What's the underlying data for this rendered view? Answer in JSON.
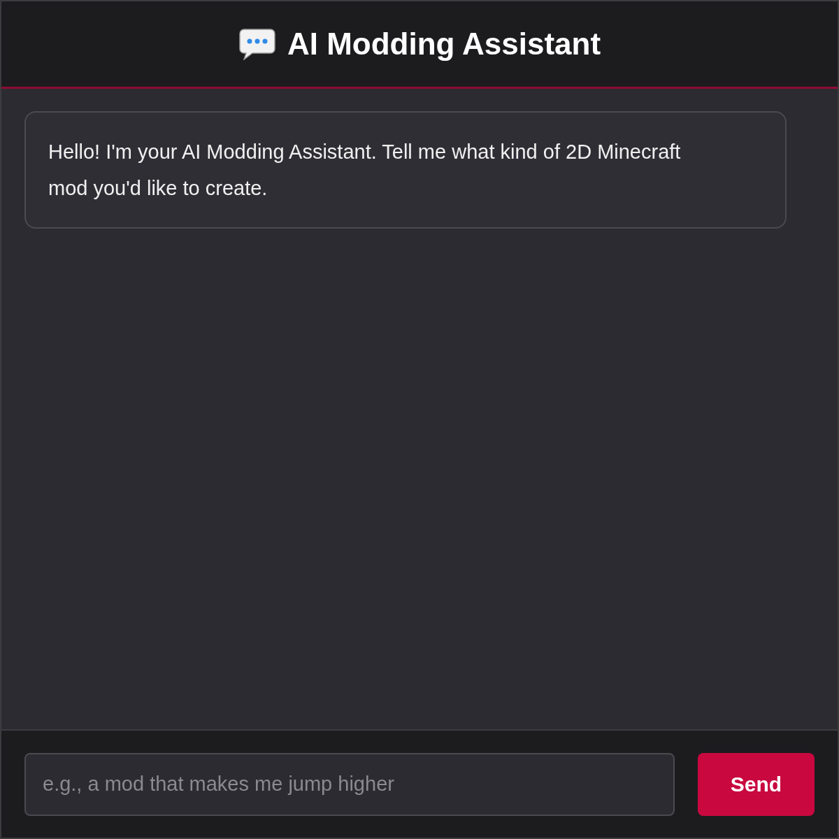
{
  "header": {
    "title": "AI Modding Assistant"
  },
  "messages": [
    {
      "kind": "assistant",
      "text": "Hello! I'm your AI Modding Assistant. Tell me what kind of 2D Minecraft mod you'd like to create."
    }
  ],
  "composer": {
    "placeholder": "e.g., a mod that makes me jump higher",
    "button": "Send"
  }
}
